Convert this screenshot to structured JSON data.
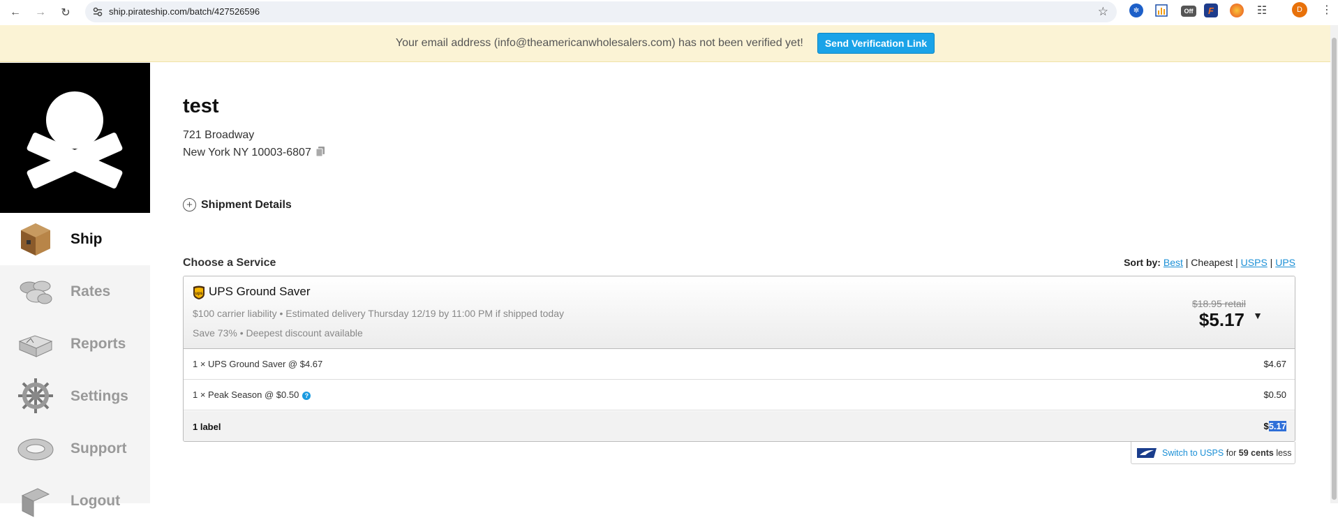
{
  "browser": {
    "url": "ship.pirateship.com/batch/427526596",
    "profile_initial": "D",
    "extensions": [
      "ext-blue-icon",
      "ext-chart-icon",
      "ext-off-icon",
      "ext-f-icon",
      "ext-firefox-icon",
      "ext-puzzle-icon"
    ],
    "off_badge": "Off"
  },
  "banner": {
    "message": "Your email address (info@theamericanwholesalers.com) has not been verified yet!",
    "button_label": "Send Verification Link"
  },
  "sidebar": {
    "items": [
      {
        "label": "Ship",
        "icon": "box-icon",
        "active": true
      },
      {
        "label": "Rates",
        "icon": "coins-icon",
        "active": false
      },
      {
        "label": "Reports",
        "icon": "book-icon",
        "active": false
      },
      {
        "label": "Settings",
        "icon": "ship-wheel-icon",
        "active": false
      },
      {
        "label": "Support",
        "icon": "life-ring-icon",
        "active": false
      },
      {
        "label": "Logout",
        "icon": "logout-icon",
        "active": false
      }
    ]
  },
  "recipient": {
    "name": "test",
    "address_line1": "721 Broadway",
    "address_line2": "New York NY 10003-6807"
  },
  "shipment_details_label": "Shipment Details",
  "services": {
    "title": "Choose a Service",
    "sort_by_label": "Sort by:",
    "sort_options": [
      "Best",
      "Cheapest",
      "USPS",
      "UPS"
    ],
    "selected": {
      "name": "UPS Ground Saver",
      "meta": "$100 carrier liability • Estimated delivery Thursday 12/19 by 11:00 PM if shipped today",
      "savings": "Save 73% • Deepest discount available",
      "retail_price": "$18.95 retail",
      "price": "$5.17"
    },
    "line_items": [
      {
        "label": "1 × UPS Ground Saver @ $4.67",
        "amount": "$4.67"
      },
      {
        "label": "1 × Peak Season @ $0.50",
        "amount": "$0.50"
      }
    ],
    "total": {
      "label": "1 label",
      "currency": "$",
      "amount": "5.17"
    },
    "switch": {
      "link": "Switch to USPS",
      "middle": "for",
      "savings": "59 cents",
      "suffix": "less"
    }
  }
}
